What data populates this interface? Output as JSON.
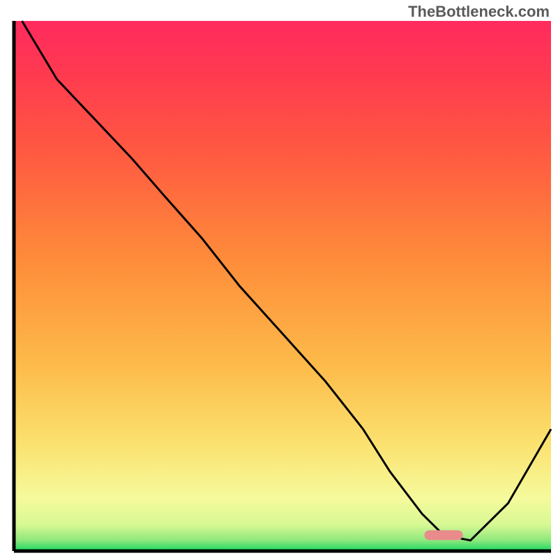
{
  "watermark": "TheBottleneck.com",
  "chart_data": {
    "type": "line",
    "title": "",
    "xlabel": "",
    "ylabel": "",
    "xlim": [
      0,
      100
    ],
    "ylim": [
      0,
      100
    ],
    "x": [
      1.5,
      8,
      22,
      28,
      35,
      42,
      50,
      58,
      65,
      70,
      76,
      80,
      85,
      92,
      100
    ],
    "y": [
      100,
      89,
      74,
      67,
      59,
      50,
      41,
      32,
      23,
      15,
      7,
      3,
      2,
      9,
      23
    ],
    "marker": {
      "x": 80,
      "y": 3
    },
    "gradient_stops": [
      {
        "offset": 0.0,
        "color": "#18d860"
      },
      {
        "offset": 0.02,
        "color": "#8de87d"
      },
      {
        "offset": 0.05,
        "color": "#d8f894"
      },
      {
        "offset": 0.1,
        "color": "#f6fa9c"
      },
      {
        "offset": 0.2,
        "color": "#fbe270"
      },
      {
        "offset": 0.35,
        "color": "#fdbb4a"
      },
      {
        "offset": 0.55,
        "color": "#fe8c3a"
      },
      {
        "offset": 0.75,
        "color": "#ff5a41"
      },
      {
        "offset": 0.9,
        "color": "#ff3a50"
      },
      {
        "offset": 1.0,
        "color": "#ff2a5e"
      }
    ]
  }
}
